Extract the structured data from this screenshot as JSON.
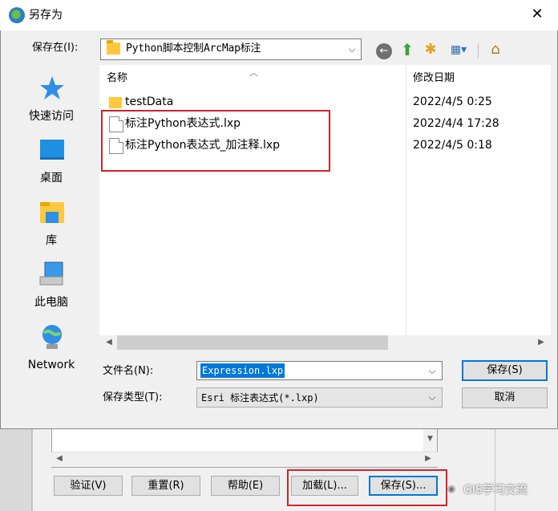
{
  "title_bar": {
    "title": "另存为"
  },
  "toolbar": {
    "save_in_label": "保存在(I):",
    "save_in_value": "Python脚本控制ArcMap标注"
  },
  "places": [
    {
      "label": "快速访问",
      "icon": "quick-access-star-icon"
    },
    {
      "label": "桌面",
      "icon": "desktop-icon"
    },
    {
      "label": "库",
      "icon": "library-icon"
    },
    {
      "label": "此电脑",
      "icon": "this-pc-icon"
    },
    {
      "label": "Network",
      "icon": "network-icon"
    }
  ],
  "file_list": {
    "columns": {
      "name": "名称",
      "date": "修改日期"
    },
    "rows": [
      {
        "name": "testData",
        "date": "2022/4/5 0:25",
        "type": "folder"
      },
      {
        "name": "标注Python表达式.lxp",
        "date": "2022/4/4 17:28",
        "type": "file"
      },
      {
        "name": "标注Python表达式_加注释.lxp",
        "date": "2022/4/5 0:18",
        "type": "file"
      }
    ]
  },
  "form": {
    "filename_label": "文件名(N):",
    "filename_value": "Expression.lxp",
    "filetype_label": "保存类型(T):",
    "filetype_value": "Esri 标注表达式(*.lxp)"
  },
  "buttons": {
    "save": "保存(S)",
    "cancel": "取消"
  },
  "background_dialog": {
    "buttons": [
      "验证(V)",
      "重置(R)",
      "帮助(E)",
      "加载(L)...",
      "保存(S)..."
    ]
  },
  "watermark": "GIS学习交流",
  "colors": {
    "accent": "#0078d7",
    "highlight": "#d1232a",
    "folder": "#ffc83d"
  }
}
